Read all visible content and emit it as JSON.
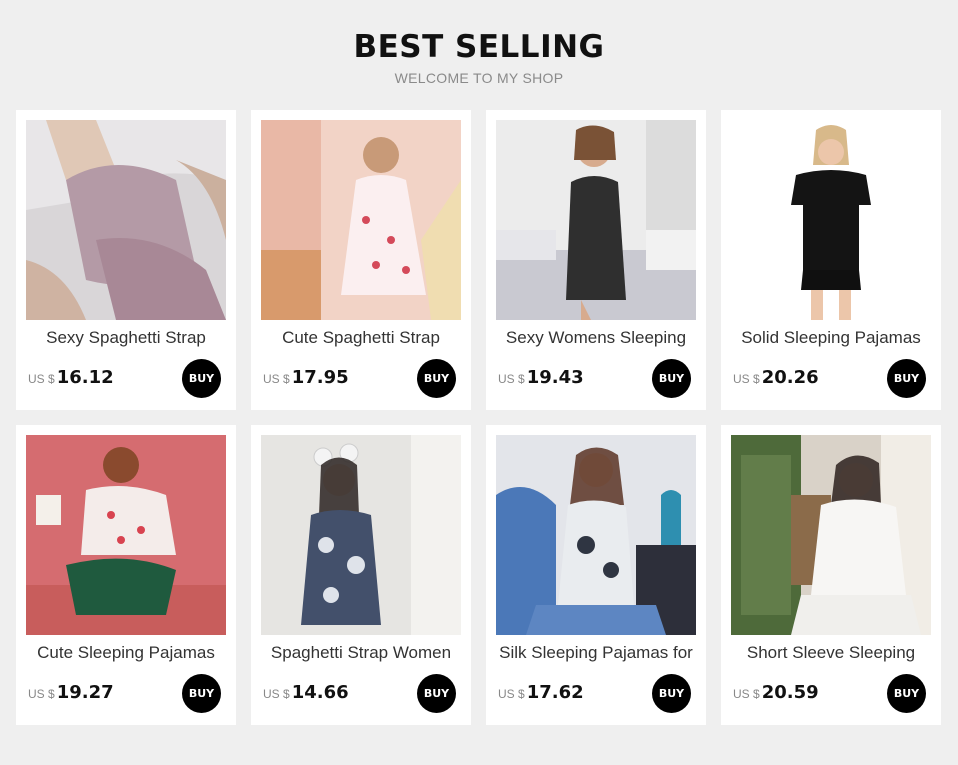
{
  "header": {
    "title": "BEST SELLING",
    "subtitle": "WELCOME TO MY SHOP"
  },
  "products": [
    {
      "name": "Sexy Spaghetti Strap",
      "currency": "US $",
      "price": "16.12",
      "buy_label": "BUY",
      "image": "lavender-satin-camisole-photo"
    },
    {
      "name": "Cute Spaghetti Strap",
      "currency": "US $",
      "price": "17.95",
      "buy_label": "BUY",
      "image": "pink-cherry-print-set-photo"
    },
    {
      "name": "Sexy Womens Sleeping",
      "currency": "US $",
      "price": "19.43",
      "buy_label": "BUY",
      "image": "black-striped-romper-photo"
    },
    {
      "name": "Solid Sleeping Pajamas",
      "currency": "US $",
      "price": "20.26",
      "buy_label": "BUY",
      "image": "black-tshirt-shorts-photo"
    },
    {
      "name": "Cute Sleeping Pajamas",
      "currency": "US $",
      "price": "19.27",
      "buy_label": "BUY",
      "image": "strawberry-shirt-green-shorts-photo"
    },
    {
      "name": "Spaghetti Strap Women",
      "currency": "US $",
      "price": "14.66",
      "buy_label": "BUY",
      "image": "floral-navy-slip-photo"
    },
    {
      "name": "Silk Sleeping Pajamas for",
      "currency": "US $",
      "price": "17.62",
      "buy_label": "BUY",
      "image": "floral-lace-silk-set-photo"
    },
    {
      "name": "Short Sleeve Sleeping",
      "currency": "US $",
      "price": "20.59",
      "buy_label": "BUY",
      "image": "white-ruffle-set-photo"
    }
  ],
  "colors": {
    "page_background": "#efefef",
    "card_background": "#ffffff",
    "buy_button": "#000000",
    "price_text": "#111111"
  }
}
